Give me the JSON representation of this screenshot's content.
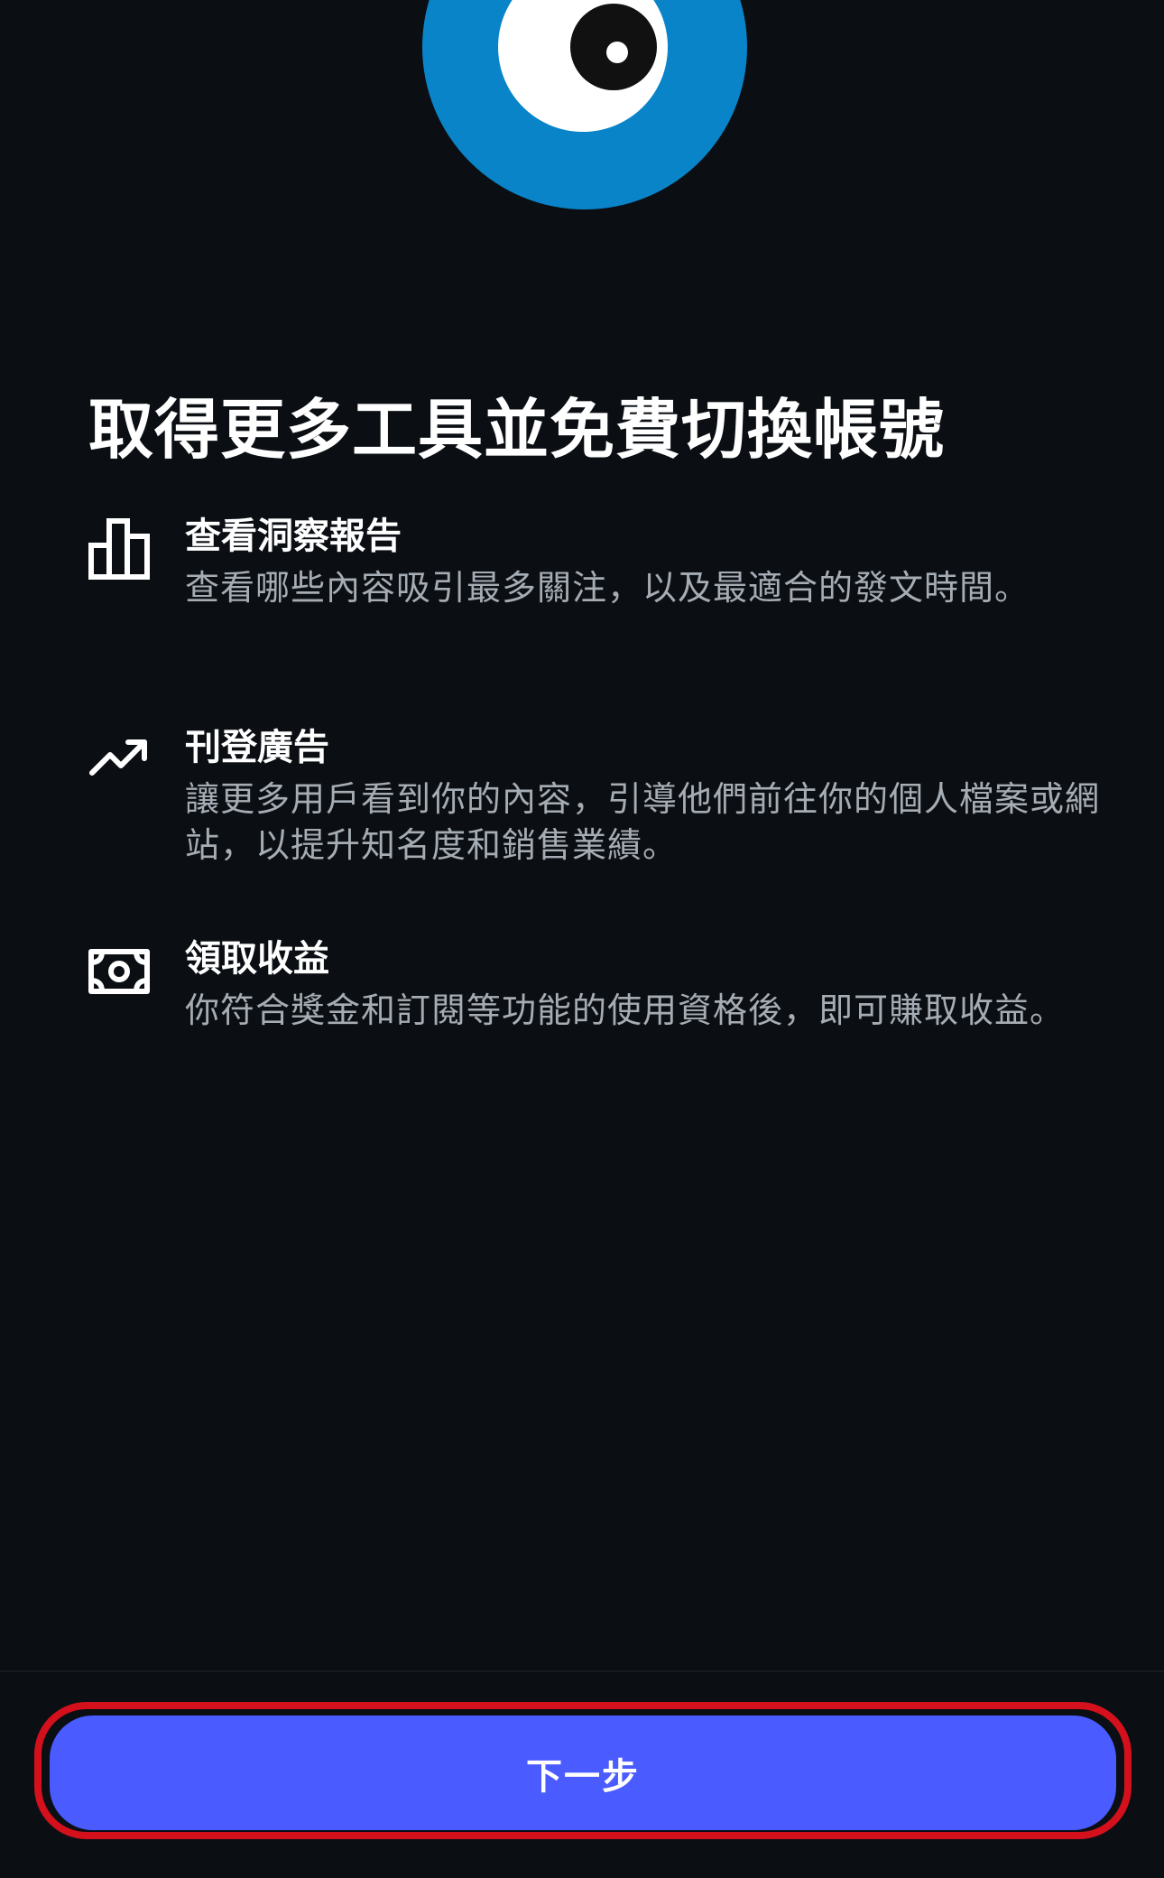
{
  "header": {
    "logo_icon": "eye-logo-icon",
    "colors": {
      "logo_blue": "#0a84c9",
      "pupil": "#111111"
    }
  },
  "title": "取得更多工具並免費切換帳號",
  "features": [
    {
      "icon": "bar-chart-icon",
      "title": "查看洞察報告",
      "description": "查看哪些內容吸引最多關注，以及最適合的發文時間。"
    },
    {
      "icon": "trending-up-icon",
      "title": "刊登廣告",
      "description": "讓更多用戶看到你的內容，引導他們前往你的個人檔案或網站，以提升知名度和銷售業績。"
    },
    {
      "icon": "money-icon",
      "title": "領取收益",
      "description": "你符合獎金和訂閱等功能的使用資格後，即可賺取收益。"
    }
  ],
  "footer": {
    "next_label": "下一步",
    "colors": {
      "button": "#4a5bff",
      "highlight": "#d4101c"
    }
  }
}
